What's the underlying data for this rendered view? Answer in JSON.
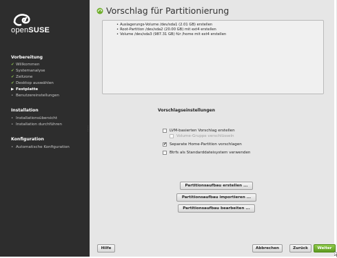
{
  "sidebar": {
    "brand_prefix": "open",
    "brand_suffix": "SUSE",
    "sections": [
      {
        "label": "Vorbereitung",
        "items": [
          {
            "label": "Willkommen",
            "state": "done"
          },
          {
            "label": "Systemanalyse",
            "state": "done"
          },
          {
            "label": "Zeitzone",
            "state": "done"
          },
          {
            "label": "Desktop auswählen",
            "state": "done"
          },
          {
            "label": "Festplatte",
            "state": "active"
          },
          {
            "label": "Benutzereinstellungen",
            "state": "pending"
          }
        ]
      },
      {
        "label": "Installation",
        "items": [
          {
            "label": "Installationsübersicht",
            "state": "pending"
          },
          {
            "label": "Installation durchführen",
            "state": "pending"
          }
        ]
      },
      {
        "label": "Konfiguration",
        "items": [
          {
            "label": "Automatische Konfiguration",
            "state": "pending"
          }
        ]
      }
    ]
  },
  "main": {
    "title": "Vorschlag für Partitionierung",
    "summary": [
      "Auslagerungs-Volume /dev/sda1 (2.01 GB) erstellen",
      "Root-Partition /dev/sda2 (20.00 GB) mit ext4 erstellen",
      "Volume /dev/sda3 (987.31 GB) für /home mit ext4 erstellen"
    ],
    "settings_title": "Vorschlagseinstellungen",
    "options": {
      "lvm": {
        "label": "LVM-basierten Vorschlag erstellen",
        "checked": false
      },
      "lvm_encrypt": {
        "label": "Volume-Gruppe verschlüsseln",
        "checked": false,
        "disabled": true
      },
      "home": {
        "label": "Separate Home-Partition vorschlagen",
        "checked": true
      },
      "btrfs": {
        "label": "Btrfs als Standarddateisystem verwenden",
        "checked": false
      }
    },
    "buttons": {
      "create": "Partitionsaufbau erstellen ...",
      "import": "Partitionsaufbau importieren ...",
      "edit": "Partitionsaufbau bearbeiten ..."
    }
  },
  "footer": {
    "help": "Hilfe",
    "abort": "Abbrechen",
    "back": "Zurück",
    "next": "Weiter"
  },
  "colors": {
    "sidebar_bg": "#2d2d2d",
    "accent_green": "#6fae2c",
    "content_bg": "#e6e6e6"
  }
}
